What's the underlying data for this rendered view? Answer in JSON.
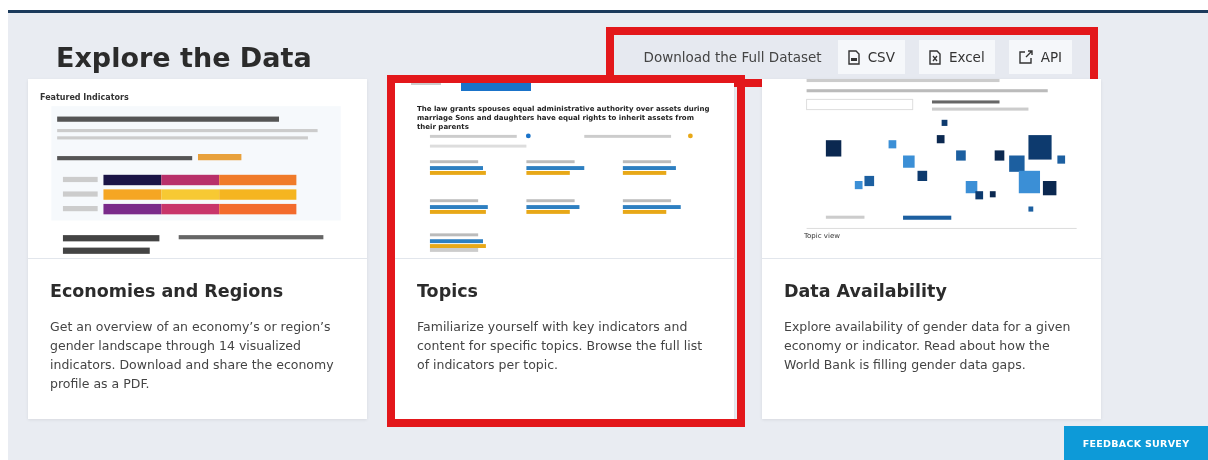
{
  "page": {
    "title": "Explore the Data"
  },
  "download": {
    "label": "Download the Full Dataset",
    "highlighted": true,
    "buttons": [
      {
        "label": "CSV",
        "kind": "file"
      },
      {
        "label": "Excel",
        "kind": "excel"
      },
      {
        "label": "API",
        "kind": "external"
      }
    ]
  },
  "cards": [
    {
      "title": "Economies and Regions",
      "description": "Get an overview of an economy’s or region’s gender landscape through 14 visualized indicators. Download and share the economy profile as a PDF.",
      "highlighted": false,
      "preview": {
        "kind": "indicators",
        "heading": "Featured Indicators"
      }
    },
    {
      "title": "Topics",
      "description": "Familiarize yourself with key indicators and content for specific topics. Browse the full list of indicators per topic.",
      "highlighted": true,
      "preview": {
        "kind": "topics",
        "heading": "The law grants spouses equal administrative authority over assets during marriage Sons and daughters have equal rights to inherit assets from their parents"
      }
    },
    {
      "title": "Data Availability",
      "description": "Explore availability of gender data for a given economy or indicator. Read about how the World Bank is filling gender data gaps.",
      "highlighted": false,
      "preview": {
        "kind": "map",
        "heading": "Topic view"
      }
    }
  ],
  "feedback_button": "FEEDBACK SURVEY"
}
